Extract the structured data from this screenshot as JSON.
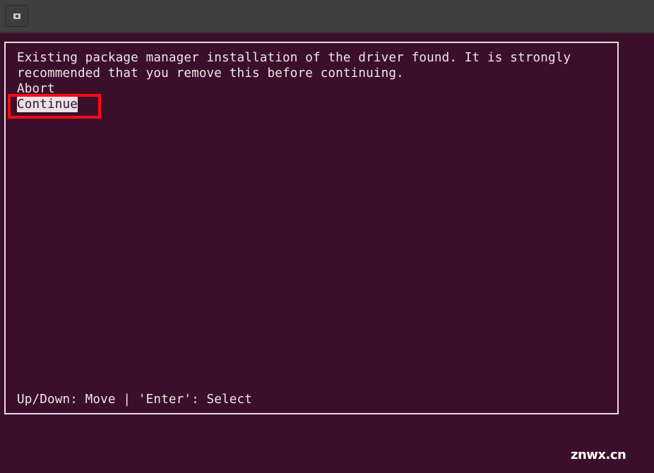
{
  "titlebar": {
    "button_icon": "terminal-menu-icon"
  },
  "dialog": {
    "message_lines": [
      "Existing package manager installation of the driver found. It is strongly",
      "recommended that you remove this before continuing."
    ],
    "options": [
      {
        "label": "Abort",
        "selected": false
      },
      {
        "label": "Continue",
        "selected": true
      }
    ],
    "hint": "Up/Down: Move | 'Enter': Select"
  },
  "annotation": {
    "highlight_color": "#ff0a14",
    "highlighted_option": "Continue"
  },
  "watermark": "znwx.cn",
  "colors": {
    "terminal_background": "#3b0f2c",
    "titlebar_background": "#3f3f3f",
    "text": "#ede6ea"
  }
}
